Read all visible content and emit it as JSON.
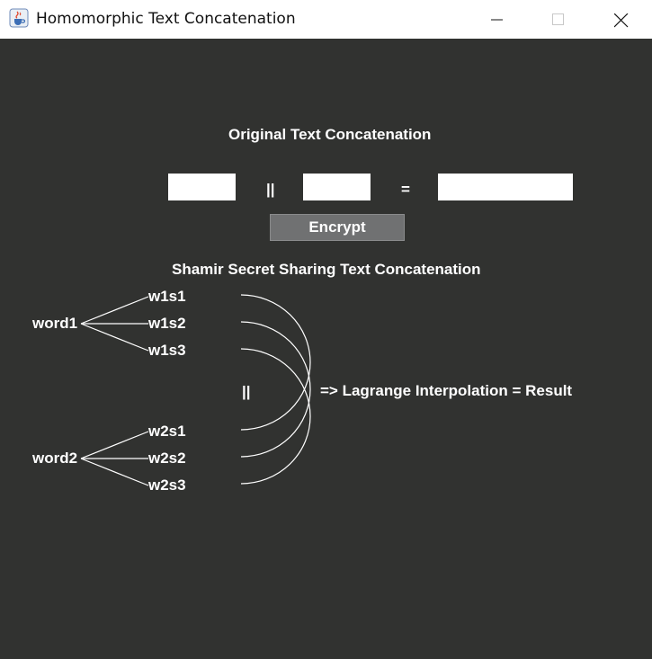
{
  "window": {
    "title": "Homomorphic Text Concatenation",
    "app_icon": "java-cup-icon"
  },
  "original": {
    "title": "Original Text Concatenation",
    "input1_value": "",
    "concat_operator": "||",
    "input2_value": "",
    "equals": "=",
    "result_value": "",
    "encrypt_label": "Encrypt"
  },
  "shamir": {
    "title": "Shamir Secret Sharing Text Concatenation",
    "word1": "word1",
    "word1_shares": [
      "w1s1",
      "w1s2",
      "w1s3"
    ],
    "concat_operator": "||",
    "word2": "word2",
    "word2_shares": [
      "w2s1",
      "w2s2",
      "w2s3"
    ],
    "result_text": "=> Lagrange Interpolation = Result"
  },
  "colors": {
    "background": "#313230",
    "text": "#ffffff",
    "button": "#707172"
  }
}
